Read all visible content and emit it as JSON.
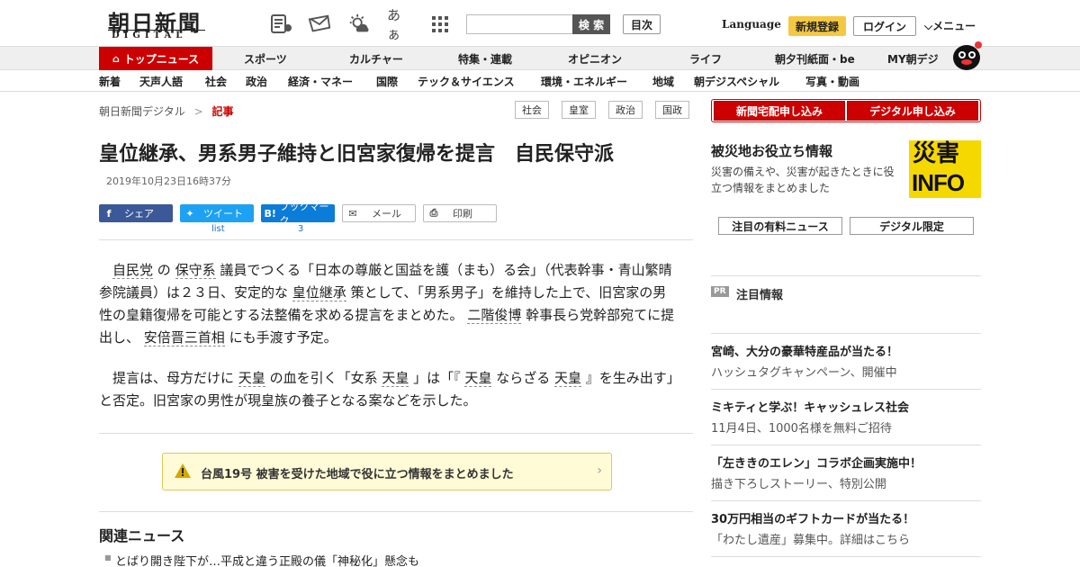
{
  "header": {
    "logo_main": "朝日新聞",
    "logo_sub": "DIGITAL",
    "font_toggle": "あぁ",
    "search_placeholder": "",
    "search_button": "検 索",
    "index_button": "目次",
    "language": "Language",
    "register": "新規登録",
    "login": "ログイン",
    "menu": "メニュー"
  },
  "nav_main": [
    "トップニュース",
    "スポーツ",
    "カルチャー",
    "特集・連載",
    "オピニオン",
    "ライフ",
    "朝夕刊紙面・be",
    "MY朝デジ"
  ],
  "nav_sub": [
    "新着",
    "天声人語",
    "社会",
    "政治",
    "経済・マネー",
    "国際",
    "テック＆サイエンス",
    "環境・エネルギー",
    "地域",
    "朝デジスペシャル",
    "写真・動画"
  ],
  "breadcrumb": {
    "home": "朝日新聞デジタル",
    "sep": ">",
    "current": "記事"
  },
  "tags": [
    "社会",
    "皇室",
    "政治",
    "国政"
  ],
  "article": {
    "title": "皇位継承、男系男子維持と旧宮家復帰を提言　自民保守派",
    "date": "2019年10月23日16時37分",
    "share": {
      "facebook": "シェア",
      "twitter": "ツイート",
      "twitter_count": "list",
      "hatena": "ブックマーク",
      "hatena_count": "3",
      "mail": "メール",
      "print": "印刷"
    },
    "p1": [
      {
        "t": "　",
        "k": false
      },
      {
        "t": "自民党",
        "k": true
      },
      {
        "t": " の ",
        "k": false
      },
      {
        "t": "保守系",
        "k": true
      },
      {
        "t": " 議員でつくる「日本の尊厳と国益を護（まも）る会」（代表幹事・青山繁晴参院議員）は２３日、安定的な ",
        "k": false
      },
      {
        "t": "皇位継承",
        "k": true
      },
      {
        "t": " 策として、「男系男子」を維持した上で、旧宮家の男性の皇籍復帰を可能とする法整備を求める提言をまとめた。 ",
        "k": false
      },
      {
        "t": "二階俊博",
        "k": true
      },
      {
        "t": " 幹事長ら党幹部宛てに提出し、 ",
        "k": false
      },
      {
        "t": "安倍晋三首相",
        "k": true
      },
      {
        "t": " にも手渡す予定。",
        "k": false
      }
    ],
    "p2": [
      {
        "t": "　提言は、母方だけに ",
        "k": false
      },
      {
        "t": "天皇",
        "k": true
      },
      {
        "t": " の血を引く「女系 ",
        "k": false
      },
      {
        "t": "天皇",
        "k": true
      },
      {
        "t": " 」は「『 ",
        "k": false
      },
      {
        "t": "天皇",
        "k": true
      },
      {
        "t": " ならざる ",
        "k": false
      },
      {
        "t": "天皇",
        "k": true
      },
      {
        "t": " 』を生み出す」と否定。旧宮家の男性が現皇族の養子となる案などを示した。",
        "k": false
      }
    ]
  },
  "alert": {
    "text": "台風19号 被害を受けた地域で役に立つ情報をまとめました"
  },
  "related": {
    "title": "関連ニュース",
    "items": [
      "とばり開き陛下が…平成と違う正殿の儀「神秘化」懸念も"
    ]
  },
  "sidebar": {
    "subscribe_paper": "新聞宅配申し込み",
    "subscribe_digital": "デジタル申し込み",
    "disaster_title": "被災地お役立ち情報",
    "disaster_desc": "災害の備えや、災害が起きたときに役立つ情報をまとめました",
    "disaster_box_top": "災害",
    "disaster_box_bottom": "INFO",
    "btn_paid_news": "注目の有料ニュース",
    "btn_digital_only": "デジタル限定",
    "pr_badge": "PR",
    "pr_label": "注目情報",
    "ads": [
      {
        "title": "宮崎、大分の豪華特産品が当たる！",
        "sub": "ハッシュタグキャンペーン、開催中"
      },
      {
        "title": "ミキティと学ぶ！キャッシュレス社会",
        "sub": "11月4日、1000名様を無料ご招待"
      },
      {
        "title": "「左ききのエレン」コラボ企画実施中！",
        "sub": "描き下ろしストーリー、特別公開"
      },
      {
        "title": "30万円相当のギフトカードが当たる！",
        "sub": "「わたし遺産」募集中。詳細はこちら"
      }
    ]
  },
  "colors": {
    "accent": "#cc0000",
    "register": "#f5c842",
    "disaster": "#f5d800",
    "facebook": "#3b5998",
    "twitter": "#1da1f2",
    "hatena": "#0b7cd8"
  }
}
